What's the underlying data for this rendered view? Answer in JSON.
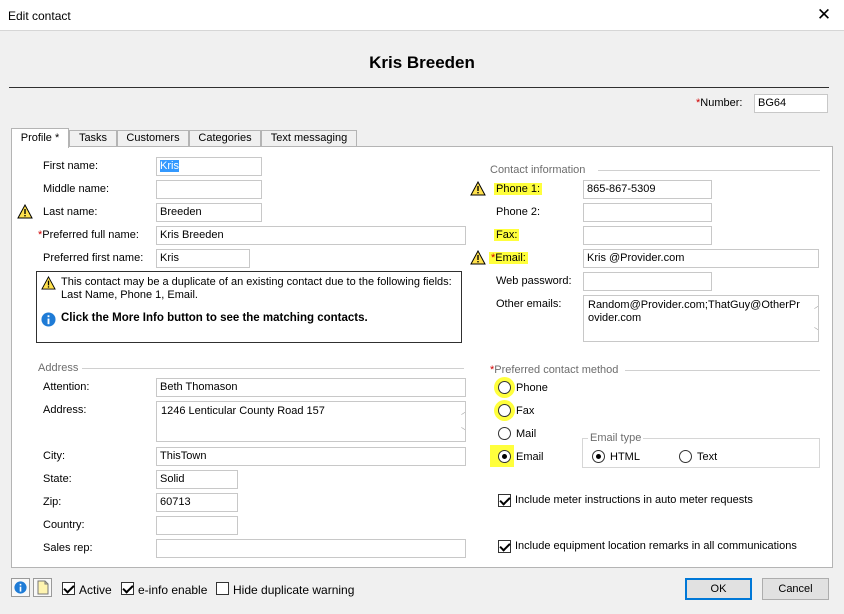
{
  "window": {
    "title": "Edit contact"
  },
  "header": {
    "name": "Kris Breeden",
    "number_label": "Number:",
    "number_value": "BG64"
  },
  "tabs": [
    {
      "label": "Profile *"
    },
    {
      "label": "Tasks"
    },
    {
      "label": "Customers"
    },
    {
      "label": "Categories"
    },
    {
      "label": "Text messaging"
    }
  ],
  "profile": {
    "first_name_label": "First name:",
    "first_name": "Kris",
    "middle_name_label": "Middle name:",
    "middle_name": "",
    "last_name_label": "Last name:",
    "last_name": "Breeden",
    "preferred_full_label": "Preferred full name:",
    "preferred_full": "Kris Breeden",
    "preferred_first_label": "Preferred first name:",
    "preferred_first": "Kris"
  },
  "duplicate_warning": {
    "line1": "This contact may be a duplicate of an existing contact due to the following fields:",
    "line2": "Last Name, Phone 1, Email.",
    "more_info": "Click the More Info button to see the matching contacts."
  },
  "contact_info": {
    "group_label": "Contact information",
    "phone1_label": "Phone 1:",
    "phone1": "865-867-5309",
    "phone2_label": "Phone 2:",
    "phone2": "",
    "fax_label": "Fax:",
    "fax": "",
    "email_label": "Email:",
    "email": "Kris @Provider.com",
    "web_password_label": "Web password:",
    "web_password": "",
    "other_emails_label": "Other emails:",
    "other_emails_line1": "Random@Provider.com;ThatGuy@OtherPr",
    "other_emails_line2": "ovider.com"
  },
  "address": {
    "group_label": "Address",
    "attention_label": "Attention:",
    "attention": "Beth Thomason",
    "address_label": "Address:",
    "address": "1246 Lenticular County Road 157",
    "city_label": "City:",
    "city": "ThisTown",
    "state_label": "State:",
    "state": "Solid",
    "zip_label": "Zip:",
    "zip": "60713",
    "country_label": "Country:",
    "country": "",
    "sales_rep_label": "Sales rep:",
    "sales_rep": ""
  },
  "preferred_contact": {
    "group_label": "Preferred contact method",
    "options": [
      "Phone",
      "Fax",
      "Mail",
      "Email"
    ],
    "selected": "Email"
  },
  "email_type": {
    "group_label": "Email type",
    "options": [
      "HTML",
      "Text"
    ],
    "selected": "HTML"
  },
  "checkboxes": {
    "meter_instructions": "Include meter instructions in auto meter requests",
    "equipment_remarks": "Include equipment location remarks in all communications"
  },
  "footer": {
    "active_label": "Active",
    "einfo_label": "e-info enable",
    "hide_dup_label": "Hide duplicate warning",
    "ok_label": "OK",
    "cancel_label": "Cancel"
  },
  "colors": {
    "highlight": "#ffff3c",
    "required": "#d00000",
    "ok_border": "#0078d7",
    "selection": "#3399ff"
  }
}
